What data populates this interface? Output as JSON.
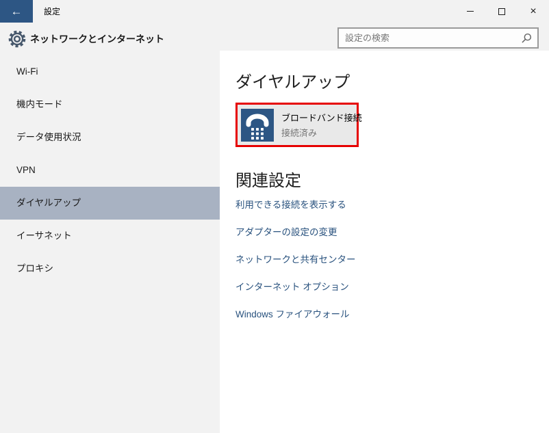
{
  "titlebar": {
    "app_title": "設定",
    "back_glyph": "←",
    "close_glyph": "×"
  },
  "header": {
    "page_title": "ネットワークとインターネット",
    "search_placeholder": "設定の検索"
  },
  "sidebar": {
    "items": [
      {
        "label": "Wi-Fi",
        "selected": false
      },
      {
        "label": "機内モード",
        "selected": false
      },
      {
        "label": "データ使用状況",
        "selected": false
      },
      {
        "label": "VPN",
        "selected": false
      },
      {
        "label": "ダイヤルアップ",
        "selected": true
      },
      {
        "label": "イーサネット",
        "selected": false
      },
      {
        "label": "プロキシ",
        "selected": false
      }
    ]
  },
  "main": {
    "section_title": "ダイヤルアップ",
    "connection": {
      "name": "ブロードバンド接続",
      "status": "接続済み",
      "highlighted": true
    },
    "related": {
      "title": "関連設定",
      "links": [
        "利用できる接続を表示する",
        "アダプターの設定の変更",
        "ネットワークと共有センター",
        "インターネット オプション",
        "Windows ファイアウォール"
      ]
    }
  },
  "icons": {
    "back": "left-arrow",
    "gear": "settings-gear",
    "search": "magnifier",
    "connection": "dialup-phone-keypad",
    "minimize": "horizontal-dash",
    "maximize": "hollow-square",
    "close": "x-cross"
  },
  "colors": {
    "accent_blue": "#2d5684",
    "sidebar_bg": "#f2f2f2",
    "header_bg": "#f2f2f2",
    "selected_highlight": "#a8b2c2",
    "link_blue": "#29527e",
    "annotation_red": "#e60000",
    "tile_bg": "#e9e9e9",
    "status_gray": "#767676"
  }
}
